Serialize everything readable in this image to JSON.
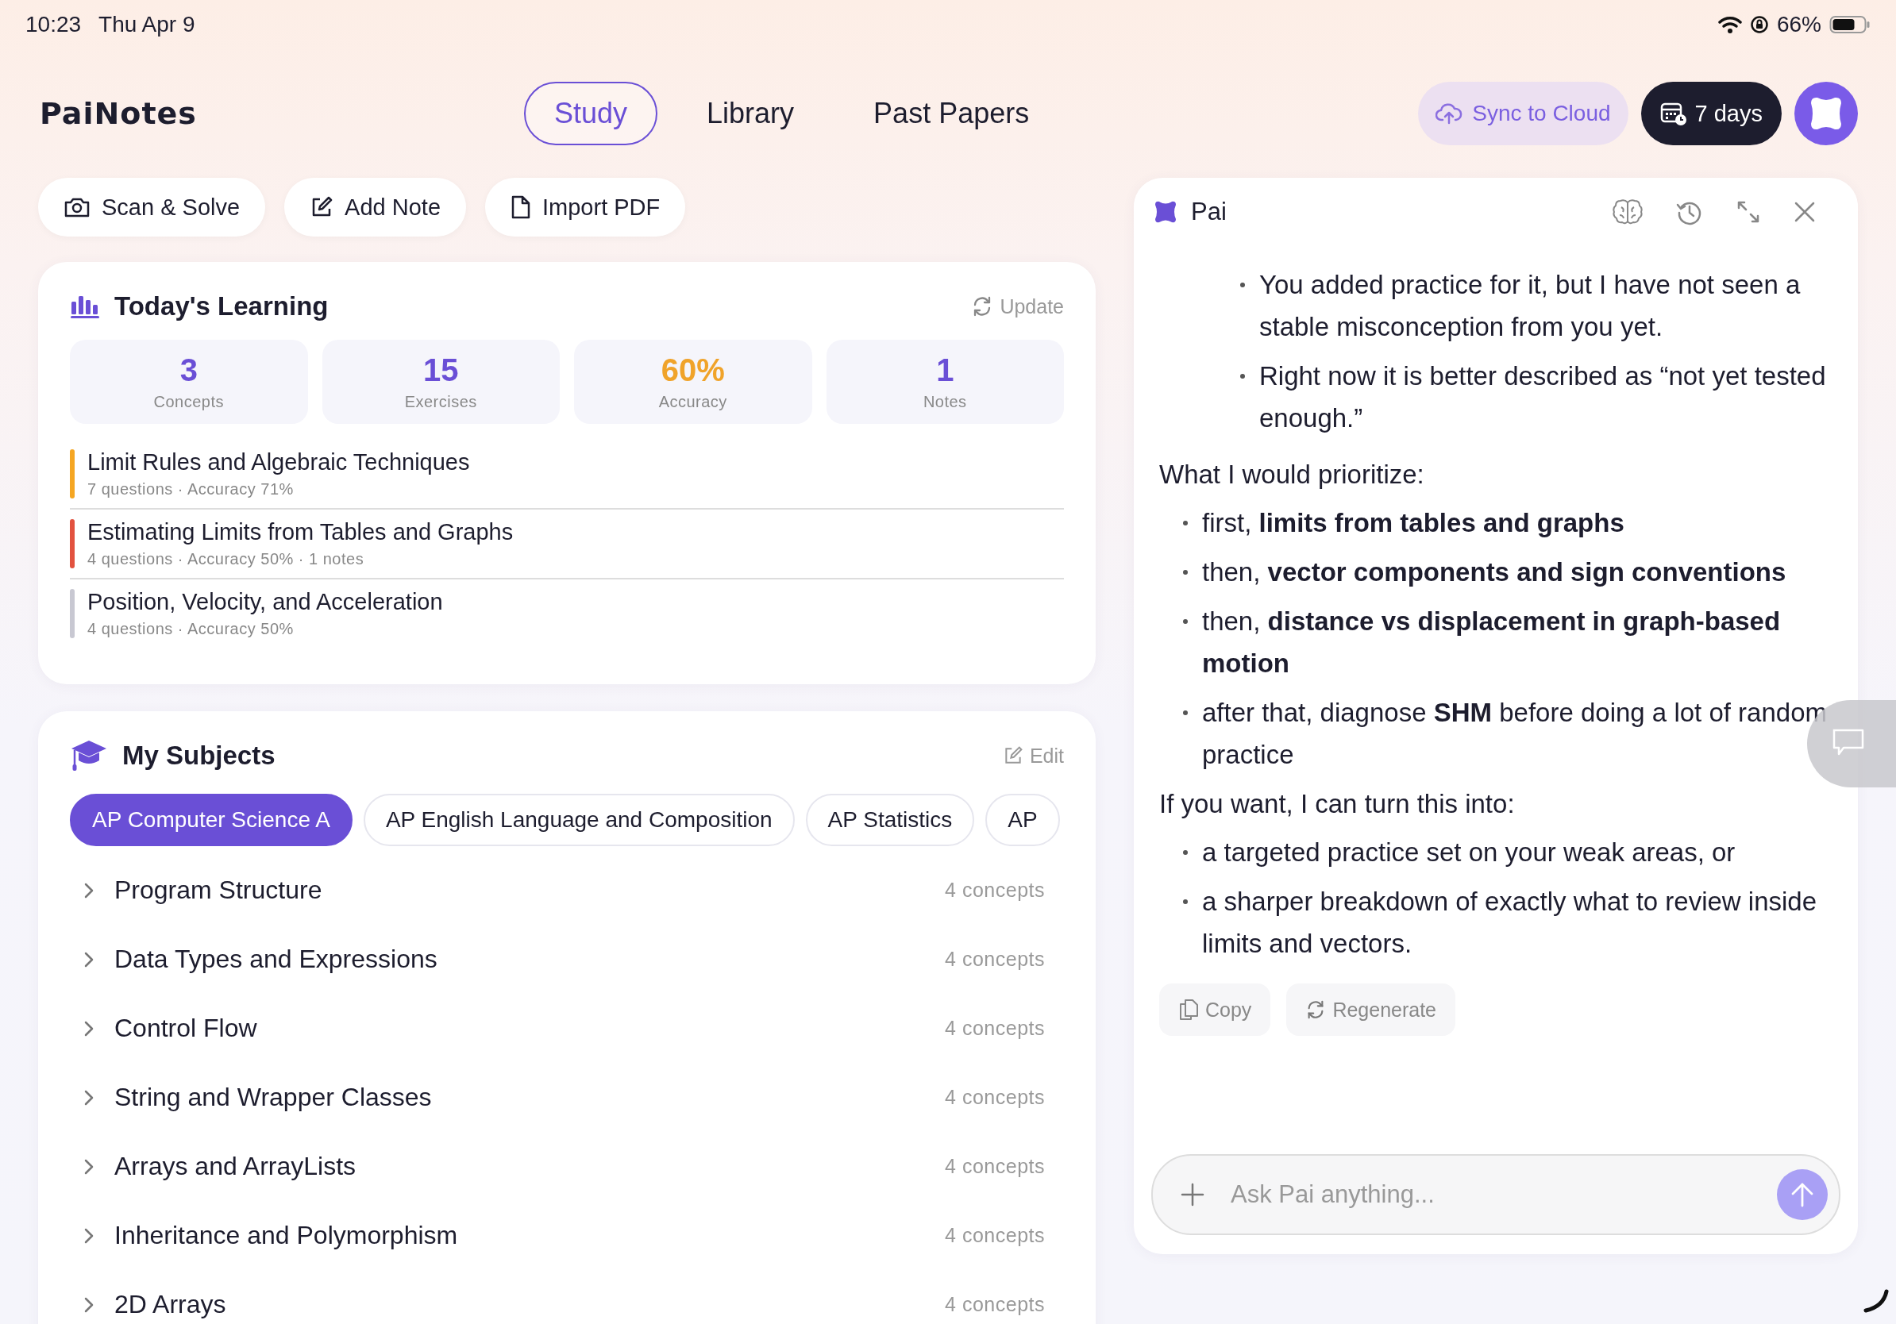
{
  "status_bar": {
    "time": "10:23",
    "date": "Thu Apr 9",
    "battery": "66%"
  },
  "header": {
    "logo": "PaiNotes",
    "nav": [
      {
        "label": "Study",
        "selected": true
      },
      {
        "label": "Library",
        "selected": false
      },
      {
        "label": "Past Papers",
        "selected": false
      }
    ],
    "sync_button": "Sync to Cloud",
    "streak_button": "7 days"
  },
  "actions": [
    "Scan & Solve",
    "Add Note",
    "Import PDF"
  ],
  "todays_learning": {
    "title": "Today's Learning",
    "update": "Update",
    "stats": [
      {
        "value": "3",
        "label": "Concepts",
        "color": "#6a4fd6"
      },
      {
        "value": "15",
        "label": "Exercises",
        "color": "#6a4fd6"
      },
      {
        "value": "60%",
        "label": "Accuracy",
        "color": "#f0a32a"
      },
      {
        "value": "1",
        "label": "Notes",
        "color": "#6a4fd6"
      }
    ],
    "items": [
      {
        "title": "Limit Rules and Algebraic Techniques",
        "meta": "7 questions · Accuracy 71%",
        "color": "#f5a623"
      },
      {
        "title": "Estimating Limits from Tables and Graphs",
        "meta": "4 questions · Accuracy 50% · 1 notes",
        "color": "#e2523f"
      },
      {
        "title": "Position, Velocity, and Acceleration",
        "meta": "4 questions · Accuracy 50%",
        "color": "#c8c8d2"
      }
    ]
  },
  "my_subjects": {
    "title": "My Subjects",
    "edit": "Edit",
    "subjects": [
      {
        "label": "AP Computer Science A",
        "selected": true
      },
      {
        "label": "AP English Language and Composition",
        "selected": false
      },
      {
        "label": "AP Statistics",
        "selected": false
      },
      {
        "label": "AP",
        "selected": false
      }
    ],
    "topics": [
      {
        "name": "Program Structure",
        "count": "4 concepts"
      },
      {
        "name": "Data Types and Expressions",
        "count": "4 concepts"
      },
      {
        "name": "Control Flow",
        "count": "4 concepts"
      },
      {
        "name": "String and Wrapper Classes",
        "count": "4 concepts"
      },
      {
        "name": "Arrays and ArrayLists",
        "count": "4 concepts"
      },
      {
        "name": "Inheritance and Polymorphism",
        "count": "4 concepts"
      },
      {
        "name": "2D Arrays",
        "count": "4 concepts"
      }
    ]
  },
  "chat": {
    "title": "Pai",
    "blocks": [
      {
        "kind": "list",
        "items": [
          {
            "children": [
              {
                "text": "You added practice for it, but I have not seen a stable misconception from you yet."
              },
              {
                "text": "Right now it is better described as “not yet tested enough.”"
              }
            ]
          }
        ]
      },
      {
        "kind": "paragraph",
        "text": "What I would prioritize:"
      },
      {
        "kind": "list",
        "items": [
          {
            "text": "first, **limits from tables and graphs**"
          },
          {
            "text": "then, **vector components and sign conventions**"
          },
          {
            "text": "then, **distance vs displacement in graph-based motion**"
          },
          {
            "text": "after that, diagnose **SHM** before doing a lot of random practice"
          }
        ]
      },
      {
        "kind": "paragraph",
        "text": "If you want, I can turn this into:"
      },
      {
        "kind": "list",
        "items": [
          {
            "text": "a targeted practice set on your weak areas, or"
          },
          {
            "text": "a sharper breakdown of exactly what to review inside limits and vectors."
          }
        ]
      }
    ],
    "copy": "Copy",
    "regenerate": "Regenerate",
    "input": {
      "placeholder": "Ask Pai anything..."
    }
  }
}
